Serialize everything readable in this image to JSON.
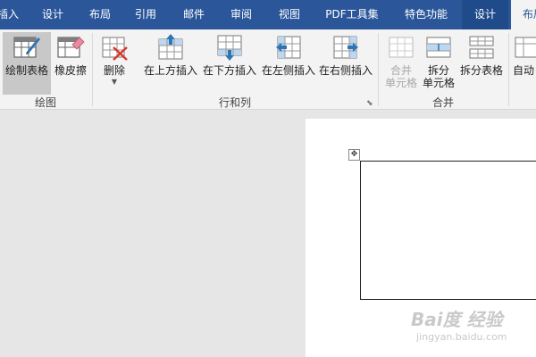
{
  "tabs": [
    "插入",
    "设计",
    "布局",
    "引用",
    "邮件",
    "审阅",
    "视图",
    "PDF工具集",
    "特色功能",
    "设计",
    "布局"
  ],
  "ribbon": {
    "draw_table": "绘制表格",
    "eraser": "橡皮擦",
    "delete": "删除",
    "insert_above": "在上方插入",
    "insert_below": "在下方插入",
    "insert_left": "在左侧插入",
    "insert_right": "在右侧插入",
    "merge_cells": "合并\n单元格",
    "split_cells": "拆分\n单元格",
    "split_table": "拆分表格",
    "autofit": "自动"
  },
  "groups": {
    "draw": "绘图",
    "rows_cols": "行和列",
    "merge": "合并"
  },
  "watermark": {
    "brand": "Bai度 经验",
    "url": "jingyan.baidu.com"
  },
  "colors": {
    "tab_bar": "#2b579a",
    "ribbon_bg": "#f3f3f3",
    "selected_button": "#c8c8c8",
    "doc_bg": "#e6e6e6"
  }
}
